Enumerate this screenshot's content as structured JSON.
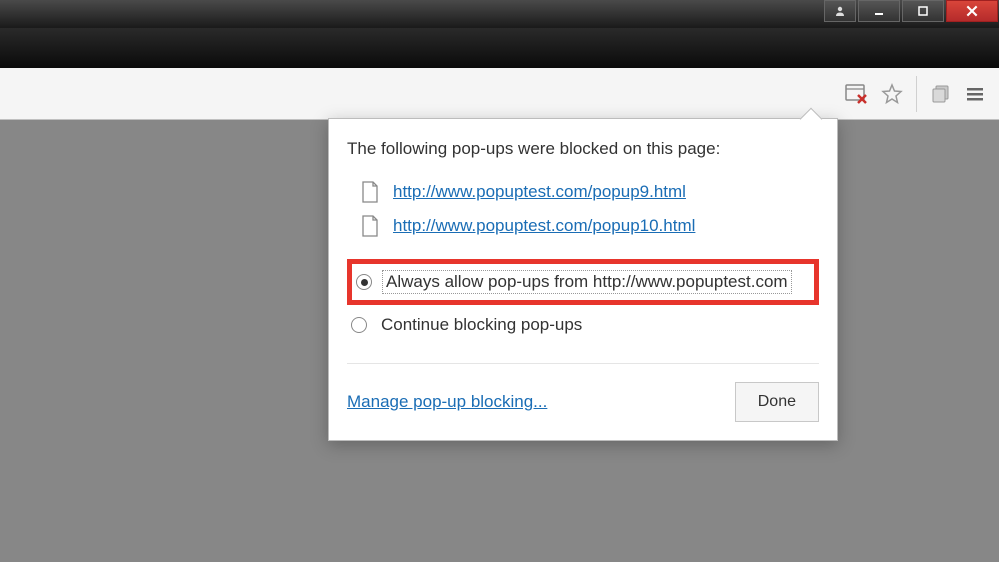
{
  "popup": {
    "title": "The following pop-ups were blocked on this page:",
    "blocked": [
      {
        "url": "http://www.popuptest.com/popup9.html"
      },
      {
        "url": "http://www.popuptest.com/popup10.html"
      }
    ],
    "options": {
      "allow_label": "Always allow pop-ups from http://www.popuptest.com",
      "block_label": "Continue blocking pop-ups"
    },
    "manage_label": "Manage pop-up blocking...",
    "done_label": "Done"
  }
}
